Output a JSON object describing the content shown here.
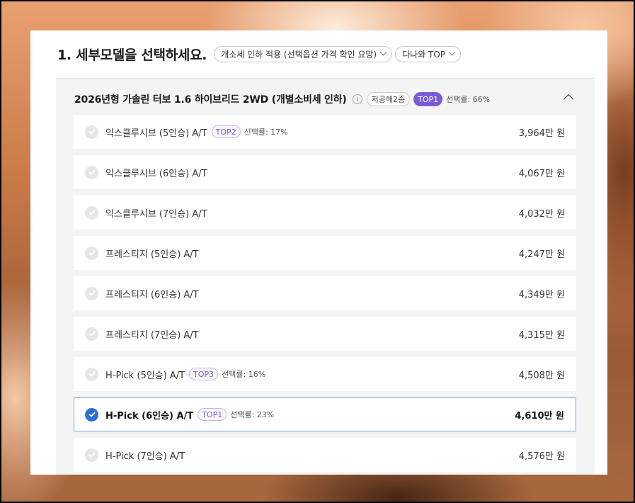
{
  "step_title": "1. 세부모델을 선택하세요.",
  "filters": [
    {
      "label": "개소세 인하 적용 (선택옵션 가격 확인 요망)"
    },
    {
      "label": "다나와 TOP"
    }
  ],
  "group": {
    "title": "2026년형 가솔린 터보 1.6 하이브리드 2WD (개별소비세 인하)",
    "info": "i",
    "variants_tag": "저공해2종",
    "rank_tag": "TOP1",
    "rate": "선택률: 66%"
  },
  "models": [
    {
      "name": "익스클루시브 (5인승) A/T",
      "tag": "TOP2",
      "rate": "선택률: 17%",
      "price": "3,964만 원",
      "selected": false
    },
    {
      "name": "익스클루시브 (6인승) A/T",
      "tag": "",
      "rate": "",
      "price": "4,067만 원",
      "selected": false
    },
    {
      "name": "익스클루시브 (7인승) A/T",
      "tag": "",
      "rate": "",
      "price": "4,032만 원",
      "selected": false
    },
    {
      "name": "프레스티지 (5인승) A/T",
      "tag": "",
      "rate": "",
      "price": "4,247만 원",
      "selected": false
    },
    {
      "name": "프레스티지 (6인승) A/T",
      "tag": "",
      "rate": "",
      "price": "4,349만 원",
      "selected": false
    },
    {
      "name": "프레스티지 (7인승) A/T",
      "tag": "",
      "rate": "",
      "price": "4,315만 원",
      "selected": false
    },
    {
      "name": "H-Pick (5인승) A/T",
      "tag": "TOP3",
      "rate": "선택률: 16%",
      "price": "4,508만 원",
      "selected": false
    },
    {
      "name": "H-Pick (6인승) A/T",
      "tag": "TOP1",
      "rate": "선택률: 23%",
      "price": "4,610만 원",
      "selected": true
    },
    {
      "name": "H-Pick (7인승) A/T",
      "tag": "",
      "rate": "",
      "price": "4,576만 원",
      "selected": false
    }
  ]
}
